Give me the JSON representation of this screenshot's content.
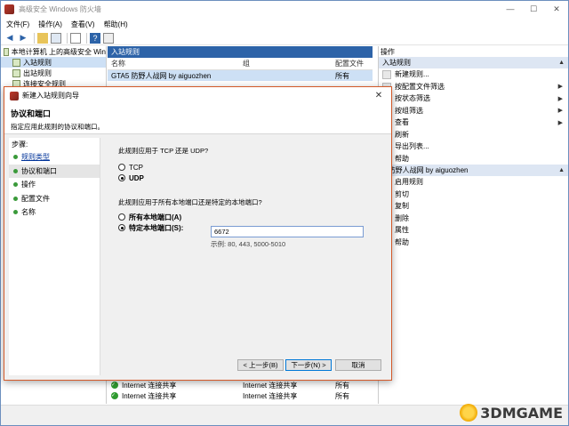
{
  "window": {
    "title": "高级安全 Windows 防火墙",
    "minimize": "—",
    "maximize": "☐",
    "close": "✕"
  },
  "menu": [
    "文件(F)",
    "操作(A)",
    "查看(V)",
    "帮助(H)"
  ],
  "tree": [
    "本地计算机 上的高级安全 Win",
    "入站规则",
    "出站规则",
    "连接安全规则"
  ],
  "center": {
    "title": "入站规则",
    "columns": [
      "名称",
      "组",
      "配置文件"
    ],
    "rows": [
      {
        "name": "GTA5 防野人战网 by aiguozhen",
        "group": "",
        "profile": "所有"
      },
      {
        "name": "Internet 连接共享",
        "group": "Internet 连接共享",
        "profile": "所有"
      },
      {
        "name": "Internet 连接共享",
        "group": "Internet 连接共享",
        "profile": "所有"
      },
      {
        "name": "Internet 连接共享",
        "group": "Internet 连接共享",
        "profile": "所有"
      }
    ]
  },
  "actions": {
    "title": "操作",
    "section1": "入站规则",
    "items1": [
      "新建规则...",
      "按配置文件筛选",
      "按状态筛选",
      "按组筛选",
      "查看",
      "刷新",
      "导出列表...",
      "帮助"
    ],
    "section2": "5 防野人战网 by aiguozhen",
    "items2": [
      "启用规则",
      "剪切",
      "复制",
      "删除",
      "属性",
      "帮助"
    ]
  },
  "wizard": {
    "title": "新建入站规则向导",
    "heading": "协议和端口",
    "subtitle": "指定应用此规则的协议和端口。",
    "steps_label": "步骤:",
    "steps": [
      "规则类型",
      "协议和端口",
      "操作",
      "配置文件",
      "名称"
    ],
    "q1": "此规则应用于 TCP 还是 UDP?",
    "opt_tcp": "TCP",
    "opt_udp": "UDP",
    "q2": "此规则应用于所有本地端口还是特定的本地端口?",
    "opt_all": "所有本地端口(A)",
    "opt_specific": "特定本地端口(S):",
    "port_value": "6672",
    "example": "示例: 80, 443, 5000-5010",
    "btn_back": "< 上一步(B)",
    "btn_next": "下一步(N) >",
    "btn_cancel": "取消"
  },
  "watermark": "3DMGAME"
}
